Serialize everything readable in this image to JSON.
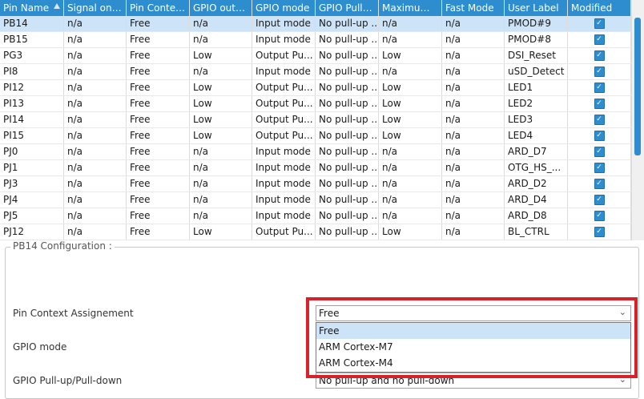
{
  "table": {
    "columns": [
      {
        "key": "pin",
        "label": "Pin Name"
      },
      {
        "key": "signal",
        "label": "Signal on ..."
      },
      {
        "key": "context",
        "label": "Pin Contex..."
      },
      {
        "key": "gpio_out",
        "label": "GPIO outp..."
      },
      {
        "key": "mode",
        "label": "GPIO mode"
      },
      {
        "key": "pull",
        "label": "GPIO Pull-..."
      },
      {
        "key": "maximum",
        "label": "Maximum ..."
      },
      {
        "key": "fast",
        "label": "Fast Mode"
      },
      {
        "key": "label",
        "label": "User Label"
      },
      {
        "key": "modified",
        "label": "Modified"
      }
    ],
    "rows": [
      [
        "PB14",
        "n/a",
        "Free",
        "n/a",
        "Input mode",
        "No pull-up ...",
        "n/a",
        "n/a",
        "PMOD#9",
        true
      ],
      [
        "PB15",
        "n/a",
        "Free",
        "n/a",
        "Input mode",
        "No pull-up ...",
        "n/a",
        "n/a",
        "PMOD#8",
        true
      ],
      [
        "PG3",
        "n/a",
        "Free",
        "Low",
        "Output Pu...",
        "No pull-up ...",
        "Low",
        "n/a",
        "DSI_Reset",
        true
      ],
      [
        "PI8",
        "n/a",
        "Free",
        "n/a",
        "Input mode",
        "No pull-up ...",
        "n/a",
        "n/a",
        "uSD_Detect",
        true
      ],
      [
        "PI12",
        "n/a",
        "Free",
        "Low",
        "Output Pu...",
        "No pull-up ...",
        "Low",
        "n/a",
        "LED1",
        true
      ],
      [
        "PI13",
        "n/a",
        "Free",
        "Low",
        "Output Pu...",
        "No pull-up ...",
        "Low",
        "n/a",
        "LED2",
        true
      ],
      [
        "PI14",
        "n/a",
        "Free",
        "Low",
        "Output Pu...",
        "No pull-up ...",
        "Low",
        "n/a",
        "LED3",
        true
      ],
      [
        "PI15",
        "n/a",
        "Free",
        "Low",
        "Output Pu...",
        "No pull-up ...",
        "Low",
        "n/a",
        "LED4",
        true
      ],
      [
        "PJ0",
        "n/a",
        "Free",
        "n/a",
        "Input mode",
        "No pull-up ...",
        "n/a",
        "n/a",
        "ARD_D7",
        true
      ],
      [
        "PJ1",
        "n/a",
        "Free",
        "n/a",
        "Input mode",
        "No pull-up ...",
        "n/a",
        "n/a",
        "OTG_HS_...",
        true
      ],
      [
        "PJ3",
        "n/a",
        "Free",
        "n/a",
        "Input mode",
        "No pull-up ...",
        "n/a",
        "n/a",
        "ARD_D2",
        true
      ],
      [
        "PJ4",
        "n/a",
        "Free",
        "n/a",
        "Input mode",
        "No pull-up ...",
        "n/a",
        "n/a",
        "ARD_D4",
        true
      ],
      [
        "PJ5",
        "n/a",
        "Free",
        "n/a",
        "Input mode",
        "No pull-up ...",
        "n/a",
        "n/a",
        "ARD_D8",
        true
      ],
      [
        "PJ12",
        "n/a",
        "Free",
        "Low",
        "Output Pu...",
        "No pull-up ...",
        "Low",
        "n/a",
        "BL_CTRL",
        true
      ]
    ],
    "selected_row": 0
  },
  "config": {
    "title": "PB14 Configuration :",
    "fields": [
      {
        "label": "Pin Context Assignement",
        "value": "Free"
      },
      {
        "label": "GPIO mode",
        "value": ""
      },
      {
        "label": "GPIO Pull-up/Pull-down",
        "value": "No pull-up and no pull-down"
      }
    ],
    "dropdown_options": [
      "Free",
      "ARM Cortex-M7",
      "ARM Cortex-M4"
    ],
    "dropdown_selected": 0
  },
  "icons": {
    "sort": "sort-ascending-icon",
    "checkbox": "checkbox-checked-icon",
    "chevron": "chevron-down-icon"
  },
  "colors": {
    "header": "#2e8dce",
    "selected_row": "#cde3f7",
    "highlight": "#d9212b"
  }
}
